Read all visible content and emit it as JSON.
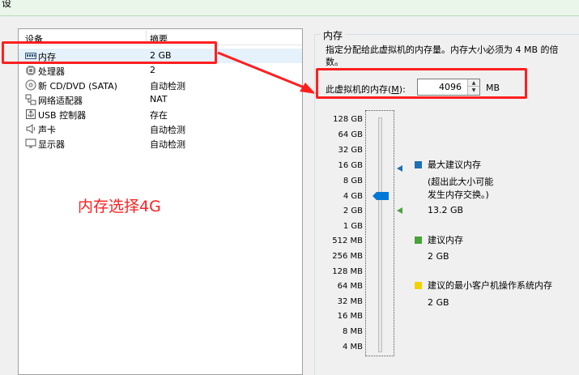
{
  "window": {
    "partial_title": "设"
  },
  "device_list": {
    "header": {
      "device": "设备",
      "summary": "摘要"
    },
    "rows": [
      {
        "name": "内存",
        "summary": "2 GB",
        "icon": "memory-icon"
      },
      {
        "name": "处理器",
        "summary": "2",
        "icon": "processor-icon"
      },
      {
        "name": "新 CD/DVD (SATA)",
        "summary": "自动检测",
        "icon": "cd-dvd-icon"
      },
      {
        "name": "网络适配器",
        "summary": "NAT",
        "icon": "network-adapter-icon"
      },
      {
        "name": "USB 控制器",
        "summary": "存在",
        "icon": "usb-icon"
      },
      {
        "name": "声卡",
        "summary": "自动检测",
        "icon": "sound-card-icon"
      },
      {
        "name": "显示器",
        "summary": "自动检测",
        "icon": "display-icon"
      }
    ]
  },
  "annotation": {
    "text": "内存选择4G",
    "color": "#ff1f1f"
  },
  "memory": {
    "title": "内存",
    "description": "指定分配给此虚拟机的内存量。内存大小必须为 4 MB 的倍数。",
    "label_prefix": "此虚拟机的内存(",
    "label_mnemonic": "M",
    "label_suffix": "):",
    "value": "4096",
    "unit": "MB",
    "scale": [
      "128 GB",
      "64 GB",
      "32 GB",
      "16 GB",
      "8 GB",
      "4 GB",
      "2 GB",
      "1 GB",
      "512 MB",
      "256 MB",
      "128 MB",
      "64 MB",
      "32 MB",
      "16 MB",
      "8 MB",
      "4 MB"
    ],
    "slider_value_index": 5,
    "legend": {
      "max_label": "最大建议内存",
      "max_note_line1": "(超出此大小可能",
      "max_note_line2": "发生内存交换。)",
      "max_value": "13.2 GB",
      "rec_label": "建议内存",
      "rec_value": "2 GB",
      "min_label": "建议的最小客户机操作系统内存",
      "min_value": "2 GB"
    },
    "colors": {
      "max": "#1f6fb5",
      "recommended": "#4aa23a",
      "minimum": "#f2d200"
    }
  }
}
